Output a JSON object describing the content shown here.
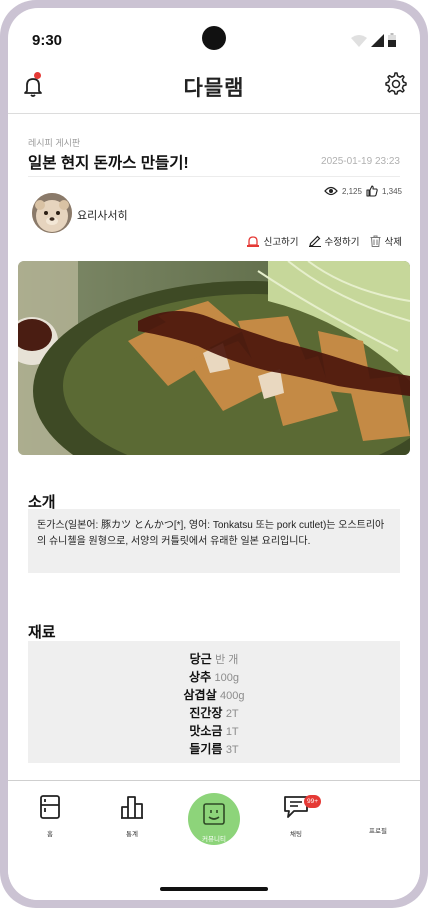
{
  "status_bar": {
    "time": "9:30"
  },
  "header": {
    "title": "다믈램",
    "notification_dot_color": "#e53935"
  },
  "post": {
    "category": "레시피 게시판",
    "title": "일본 현지 돈까스 만들기!",
    "date": "2025-01-19 23:23",
    "views": "2,125",
    "likes": "1,345",
    "author": "요리사서히",
    "actions": {
      "report": "신고하기",
      "edit": "수정하기",
      "delete": "삭제"
    }
  },
  "intro": {
    "heading": "소개",
    "text": "돈가스(일본어: 豚カツ とんかつ[*], 영어: Tonkatsu 또는 pork cutlet)는 오스트리아의 슈니첼을 원형으로, 서양의 커틀릿에서 유래한 일본 요리입니다."
  },
  "ingredients": {
    "heading": "재료",
    "items": [
      {
        "name": "당근",
        "amount": "반 개"
      },
      {
        "name": "상추",
        "amount": "100g"
      },
      {
        "name": "삼겹살",
        "amount": "400g"
      },
      {
        "name": "진간장",
        "amount": "2T"
      },
      {
        "name": "맛소금",
        "amount": "1T"
      },
      {
        "name": "들기름",
        "amount": "3T"
      }
    ]
  },
  "nav": {
    "home": "홈",
    "stats": "통계",
    "community": "커뮤니티",
    "chat": "채팅",
    "chat_badge": "99+",
    "profile": "프로필",
    "accent_color": "#8dd47a"
  },
  "icons": [
    "bell-icon",
    "gear-icon",
    "eye-icon",
    "thumbs-up-icon",
    "siren-icon",
    "pencil-icon",
    "trash-icon",
    "fridge-icon",
    "bar-chart-icon",
    "smiley-icon",
    "chat-icon"
  ]
}
